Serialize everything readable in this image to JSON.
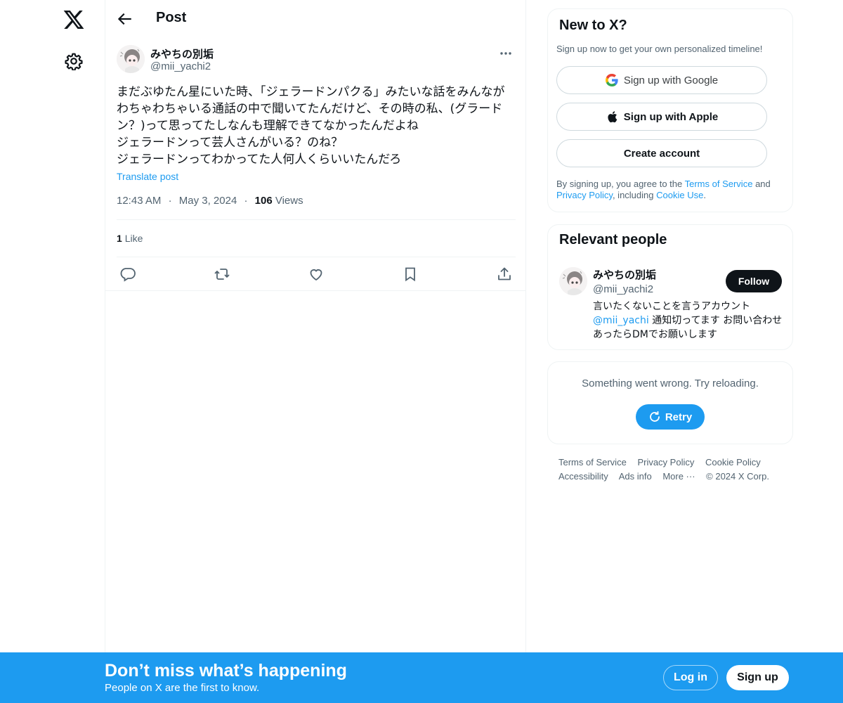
{
  "header": {
    "title": "Post"
  },
  "post": {
    "author_name": "みやちの別垢",
    "author_handle": "@mii_yachi2",
    "text": "まだぶゆたん星にいた時、「ジェラードンパクる」みたいな話をみんなが\nわちゃわちゃいる通話の中で聞いてたんだけど、その時の私、(グラード\nン？)って思ってたしなんも理解できてなかったんだよね\nジェラードンって芸人さんがいる？のね？\nジェラードンってわかってた人何人くらいいたんだろ",
    "translate_label": "Translate post",
    "time": "12:43 AM",
    "date": "May 3, 2024",
    "separator": "·",
    "views_count": "106",
    "views_label": "Views",
    "likes_count": "1",
    "likes_label": "Like"
  },
  "signup_card": {
    "title": "New to X?",
    "subtitle": "Sign up now to get your own personalized timeline!",
    "google_label": "Sign up with Google",
    "apple_label": "Sign up with Apple",
    "create_label": "Create account",
    "legal_prefix": "By signing up, you agree to the",
    "terms_label": "Terms of Service",
    "and_label": "and",
    "privacy_label": "Privacy Policy",
    "including_label": ", including",
    "cookie_label": "Cookie Use",
    "period": "."
  },
  "relevant_people": {
    "title": "Relevant people",
    "name": "みやちの別垢",
    "handle": "@mii_yachi2",
    "follow_label": "Follow",
    "bio_line1": "言いたくないことを言うアカウント",
    "bio_mention": "@mii_yachi",
    "bio_rest": " 通知切ってます お問い合わせあったらDMでお願いします"
  },
  "error_card": {
    "message": "Something went wrong. Try reloading.",
    "retry_label": "Retry"
  },
  "footer": {
    "terms": "Terms of Service",
    "privacy": "Privacy Policy",
    "cookie": "Cookie Policy",
    "accessibility": "Accessibility",
    "ads": "Ads info",
    "more": "More ···",
    "copyright": "© 2024 X Corp."
  },
  "bottom_bar": {
    "title": "Don’t miss what’s happening",
    "subtitle": "People on X are the first to know.",
    "login_label": "Log in",
    "signup_label": "Sign up"
  },
  "icons": {
    "logo": "x-logo-icon",
    "settings": "gear-icon",
    "back": "arrow-left-icon",
    "more": "more-dots-icon",
    "reply": "reply-icon",
    "repost": "repost-icon",
    "like": "heart-icon",
    "bookmark": "bookmark-icon",
    "share": "share-icon",
    "google": "google-icon",
    "apple": "apple-icon",
    "retry": "refresh-icon"
  },
  "colors": {
    "accent": "#1d9bf0",
    "text": "#0f1419",
    "secondary": "#536471",
    "border": "#eff3f4"
  }
}
